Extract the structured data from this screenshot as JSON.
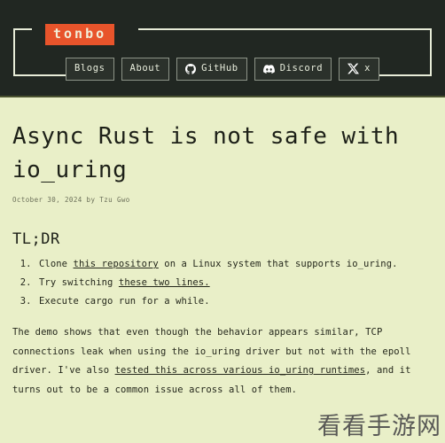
{
  "site": {
    "logo_text": "tonbo",
    "logo_bg": "#e8542b",
    "header_bg": "#212722",
    "body_bg": "#e9efc8"
  },
  "nav": {
    "items": [
      {
        "label": "Blogs",
        "icon": "none"
      },
      {
        "label": "About",
        "icon": "none"
      },
      {
        "label": "GitHub",
        "icon": "github-icon"
      },
      {
        "label": "Discord",
        "icon": "discord-icon"
      },
      {
        "label": "x",
        "icon": "x-icon"
      }
    ]
  },
  "article": {
    "title": "Async Rust is not safe with io_uring",
    "byline": "October 30, 2024 by Tzu Gwo",
    "date": "October 30, 2024",
    "author": "Tzu Gwo",
    "section_title": "TL;DR",
    "tldr": [
      {
        "before": "Clone ",
        "link": "this repository",
        "after": " on a Linux system that supports io_uring."
      },
      {
        "before": "Try switching ",
        "link": "these two lines.",
        "after": ""
      },
      {
        "before": "Execute cargo run for a while.",
        "link": "",
        "after": ""
      }
    ],
    "paragraph_before": "The demo shows that even though the behavior appears similar, TCP connections leak when using the io_uring driver but not with the epoll driver. I've also ",
    "paragraph_link": "tested this across various io_uring runtimes",
    "paragraph_after": ", and it turns out to be a common issue across all of them."
  },
  "watermark": "看看手游网"
}
